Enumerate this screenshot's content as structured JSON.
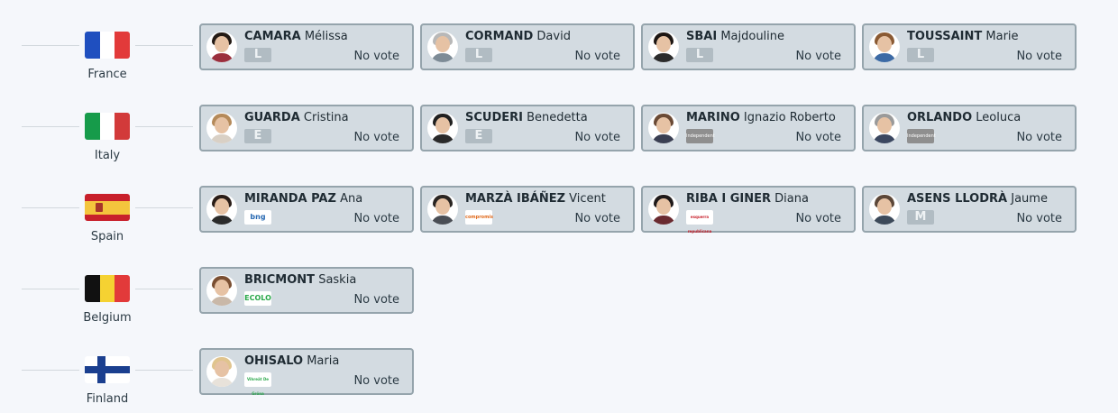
{
  "colors": {
    "card_bg": "#d3dbe1",
    "card_border": "#95a4ac",
    "page_bg": "#f5f7fb"
  },
  "rows": [
    {
      "country": "France",
      "flag": [
        "#1f4fbf",
        "#ffffff",
        "#e23a3a"
      ],
      "members": [
        {
          "surname": "CAMARA",
          "given": "Mélissa",
          "party": "L",
          "party_type": "letter",
          "vote": "No vote",
          "hair": "#231a14",
          "shirt": "#9b2f3d"
        },
        {
          "surname": "CORMAND",
          "given": "David",
          "party": "L",
          "party_type": "letter",
          "vote": "No vote",
          "hair": "#b8b8b8",
          "shirt": "#7d8b96"
        },
        {
          "surname": "SBAI",
          "given": "Majdouline",
          "party": "L",
          "party_type": "letter",
          "vote": "No vote",
          "hair": "#1d1613",
          "shirt": "#2c2c2c"
        },
        {
          "surname": "TOUSSAINT",
          "given": "Marie",
          "party": "L",
          "party_type": "letter",
          "vote": "No vote",
          "hair": "#8a5a33",
          "shirt": "#3c6aa5"
        }
      ]
    },
    {
      "country": "Italy",
      "flag": [
        "#169b4a",
        "#ffffff",
        "#d23a3a"
      ],
      "members": [
        {
          "surname": "GUARDA",
          "given": "Cristina",
          "party": "E",
          "party_type": "letter",
          "vote": "No vote",
          "hair": "#b58a5a",
          "shirt": "#d9d0c5"
        },
        {
          "surname": "SCUDERI",
          "given": "Benedetta",
          "party": "E",
          "party_type": "letter",
          "vote": "No vote",
          "hair": "#202020",
          "shirt": "#2a2a2a"
        },
        {
          "surname": "MARINO",
          "given": "Ignazio Roberto",
          "party": "Independent",
          "party_type": "indep",
          "vote": "No vote",
          "hair": "#6a4a35",
          "shirt": "#3a3f52"
        },
        {
          "surname": "ORLANDO",
          "given": "Leoluca",
          "party": "Independent",
          "party_type": "indep",
          "vote": "No vote",
          "hair": "#9a9a9a",
          "shirt": "#3b4760"
        }
      ]
    },
    {
      "country": "Spain",
      "flag": [
        "#c8202b",
        "#f4c53d",
        "#c8202b"
      ],
      "members": [
        {
          "surname": "MIRANDA PAZ",
          "given": "Ana",
          "party": "bng",
          "party_type": "logo",
          "vote": "No vote",
          "hair": "#2a1d17",
          "shirt": "#2b2b2b"
        },
        {
          "surname": "MARZÀ IBÁÑEZ",
          "given": "Vicent",
          "party": "compromís",
          "party_type": "comp",
          "vote": "No vote",
          "hair": "#2a2522",
          "shirt": "#4a4e55"
        },
        {
          "surname": "RIBA I GINER",
          "given": "Diana",
          "party": "esquerra republicana",
          "party_type": "erc",
          "vote": "No vote",
          "hair": "#1f1a1a",
          "shirt": "#6a2a30"
        },
        {
          "surname": "ASENS LLODRÀ",
          "given": "Jaume",
          "party": "M",
          "party_type": "letter",
          "vote": "No vote",
          "hair": "#5c4738",
          "shirt": "#3d4a5a"
        }
      ]
    },
    {
      "country": "Belgium",
      "flag": [
        "#111111",
        "#f5d232",
        "#e23a3a"
      ],
      "members": [
        {
          "surname": "BRICMONT",
          "given": "Saskia",
          "party": "ECOLO",
          "party_type": "ecolo",
          "vote": "No vote",
          "hair": "#7a4f32",
          "shirt": "#c9b8a8"
        }
      ]
    },
    {
      "country": "Finland",
      "flag": [
        "finland"
      ],
      "members": [
        {
          "surname": "OHISALO",
          "given": "Maria",
          "party": "Vihreät De Gröna",
          "party_type": "vihr",
          "vote": "No vote",
          "hair": "#e0c48e",
          "shirt": "#e8e2da"
        }
      ]
    }
  ]
}
